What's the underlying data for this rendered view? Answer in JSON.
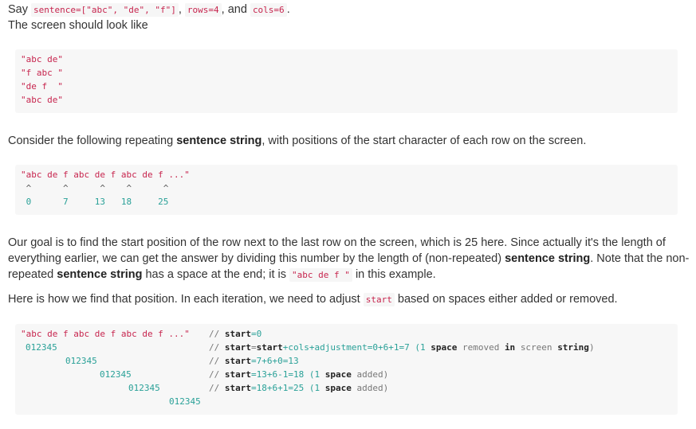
{
  "intro": {
    "say": "Say",
    "code1": "sentence=[\"abc\", \"de\", \"f\"]",
    "sep1": ",",
    "code2": "rows=4",
    "sep2": ", and",
    "code3": "cols=6",
    "end": ".",
    "line2": "The screen should look like"
  },
  "screen_block": {
    "lines": [
      "\"abc de\"",
      "\"f abc \"",
      "\"de f  \"",
      "\"abc de\""
    ]
  },
  "consider": {
    "pre": "Consider the following repeating",
    "bold": "sentence string",
    "post": ", with positions of the start character of each row on the screen."
  },
  "block2": {
    "line": "\"abc de f abc de f abc de f ...\"",
    "carets": " ^      ^      ^    ^      ^",
    "positions": " 0      7     13   18     25"
  },
  "goal": {
    "l1": "Our goal is to find the start position of the row next to the last row on the screen, which is 25 here. Since actually it's the length of",
    "l2_pre": "everything earlier, we can get the answer by dividing this number by the length of (non-repeated)",
    "l2_bold": "sentence string",
    "l2_post": ". Note that the non-",
    "l3_pre": "repeated",
    "l3_bold": "sentence string",
    "l3_mid": "has a space at the end; it is",
    "l3_code": "\"abc de f \"",
    "l3_post": "in this example."
  },
  "here": {
    "pre": "Here is how we find that position. In each iteration, we need to adjust",
    "code": "start",
    "post": "based on spaces either added or removed."
  },
  "block3": {
    "string": "\"abc de f abc de f abc de f ...\"",
    "digits": "012345",
    "c1_slash": "//",
    "c1_kw": "start",
    "c1_rest": "=0",
    "c2_slash": "//",
    "c2_kw1": "start",
    "c2_eq": "=",
    "c2_kw2": "start",
    "c2_rest": "+cols+adjustment=0+6+1=7",
    "c2_p1": "(1",
    "c2_kw3": "space",
    "c2_p2": "removed",
    "c2_kw4": "in",
    "c2_p3": "screen",
    "c2_kw5": "string",
    "c2_p4": ")",
    "c3_slash": "//",
    "c3_kw": "start",
    "c3_rest": "=7+6+0=13",
    "c4_slash": "//",
    "c4_kw": "start",
    "c4_rest": "=13+6-1=18",
    "c4_p1": "(1",
    "c4_kw2": "space",
    "c4_p2": "added)",
    "c5_slash": "//",
    "c5_kw": "start",
    "c5_rest": "=18+6+1=25",
    "c5_p1": "(1",
    "c5_kw2": "space",
    "c5_p2": "added)"
  }
}
